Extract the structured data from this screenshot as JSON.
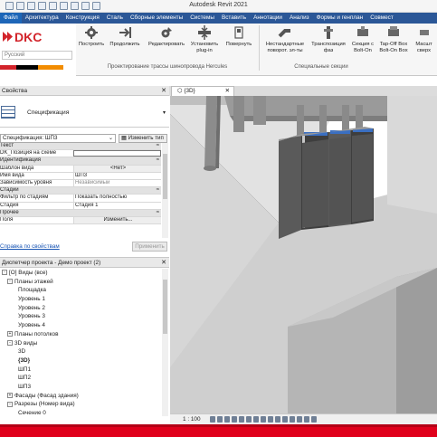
{
  "app": {
    "title": "Autodesk Revit 2021"
  },
  "tabs": [
    "Файл",
    "Архитектура",
    "Конструкция",
    "Сталь",
    "Сборные элементы",
    "Системы",
    "Вставить",
    "Аннотации",
    "Анализ",
    "Формы и генплан",
    "Совмест"
  ],
  "ribbon": {
    "logo": "DKC",
    "logo_dropdown": "Русский",
    "buttons": [
      {
        "label": "Построить"
      },
      {
        "label": "Продолжить"
      },
      {
        "label": "Редактировать"
      },
      {
        "label": "Установить plug-in"
      },
      {
        "label": "Повернуть"
      },
      {
        "label": "Нестандартные поворот. эл-ты"
      },
      {
        "label": "Транспозиция фаз"
      },
      {
        "label": "Секция с Bolt-On"
      },
      {
        "label": "Tap-Off Box Bolt-On Box"
      },
      {
        "label": "Масшт сверх"
      }
    ],
    "group1_label": "Проектирование трассы шинопровода Hercules",
    "group2_label": "Специальные секции",
    "brand_colors": [
      "#d2232a",
      "#000000",
      "#f28c00",
      "#ffffff"
    ]
  },
  "properties": {
    "header": "Свойства",
    "type_name": "Спецификация",
    "instance_selector": "Спецификация: ШП3",
    "edit_type": "Изменить тип",
    "rows": [
      {
        "k": "Текст",
        "v": "",
        "cat": true
      },
      {
        "k": "DK_Позиция на схеме",
        "v": "",
        "input": true
      },
      {
        "k": "Идентификация",
        "v": "",
        "cat": true
      },
      {
        "k": "Шаблон вида",
        "v": "<Нет>",
        "btn": true
      },
      {
        "k": "Имя вида",
        "v": "ШП3"
      },
      {
        "k": "Зависимость уровня",
        "v": "Независимый",
        "grey": true
      },
      {
        "k": "Стадии",
        "v": "",
        "cat": true
      },
      {
        "k": "Фильтр по стадиям",
        "v": "Показать полностью"
      },
      {
        "k": "Стадия",
        "v": "Стадия 1"
      },
      {
        "k": "Прочее",
        "v": "",
        "cat": true
      },
      {
        "k": "Поля",
        "v": "Изменить...",
        "btn": true
      }
    ],
    "help_link": "Справка по свойствам",
    "apply_button": "Применить"
  },
  "browser": {
    "header": "Диспетчер проекта - Демо проект (2)",
    "items": [
      {
        "label": "[O] Виды (все)",
        "indent": 0,
        "exp": "-"
      },
      {
        "label": "Планы этажей",
        "indent": 1,
        "exp": "-"
      },
      {
        "label": "Площадка",
        "indent": 3
      },
      {
        "label": "Уровень 1",
        "indent": 3
      },
      {
        "label": "Уровень 2",
        "indent": 3
      },
      {
        "label": "Уровень 3",
        "indent": 3
      },
      {
        "label": "Уровень 4",
        "indent": 3
      },
      {
        "label": "Планы потолков",
        "indent": 1,
        "exp": "+"
      },
      {
        "label": "3D виды",
        "indent": 1,
        "exp": "-"
      },
      {
        "label": "3D",
        "indent": 3
      },
      {
        "label": "{3D}",
        "indent": 3,
        "bold": true
      },
      {
        "label": "ШП1",
        "indent": 3
      },
      {
        "label": "ШП2",
        "indent": 3
      },
      {
        "label": "ШП3",
        "indent": 3
      },
      {
        "label": "Фасады (Фасад здания)",
        "indent": 1,
        "exp": "+"
      },
      {
        "label": "Разрезы (Номер вида)",
        "indent": 1,
        "exp": "-"
      },
      {
        "label": "Сечение 0",
        "indent": 3
      }
    ]
  },
  "view": {
    "tab_label": "{3D}",
    "scale": "1 : 100"
  }
}
